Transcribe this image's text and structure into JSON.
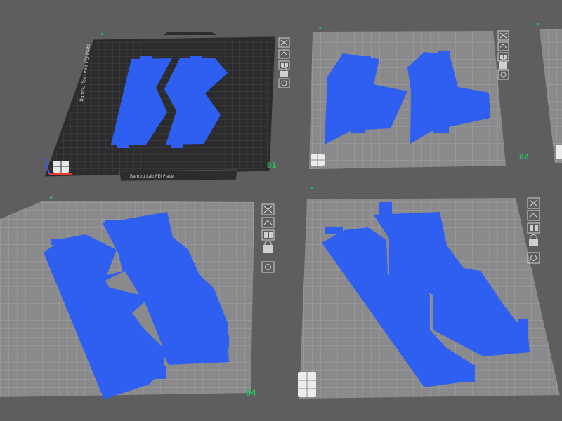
{
  "app": {
    "view": "multi-plate 3D viewport"
  },
  "colors": {
    "background": "#5e5e60",
    "plate_main": "#8a8a8c",
    "plate_grid": "#a9a9ab",
    "plate_dark": "#2c2c2e",
    "part": "#2f5ff0",
    "plate_number": "#22c55e"
  },
  "plates": [
    {
      "id": "plate-1",
      "number": "01",
      "selected": true,
      "bed_label": "Bambu Textured PEI Plate",
      "bottom_label": "Bambu Lab PEI Plate"
    },
    {
      "id": "plate-2",
      "number": "02",
      "selected": false
    },
    {
      "id": "plate-3",
      "number": "",
      "selected": false
    },
    {
      "id": "plate-4",
      "number": "04",
      "selected": false
    },
    {
      "id": "plate-5",
      "number": "",
      "selected": false
    }
  ],
  "plate_tools": [
    {
      "name": "close-plate",
      "icon": "close-icon"
    },
    {
      "name": "auto-orient",
      "icon": "orient-icon"
    },
    {
      "name": "arrange",
      "icon": "arrange-icon"
    },
    {
      "name": "lock-plate",
      "icon": "lock-icon"
    },
    {
      "name": "plate-settings",
      "icon": "gear-icon"
    }
  ]
}
